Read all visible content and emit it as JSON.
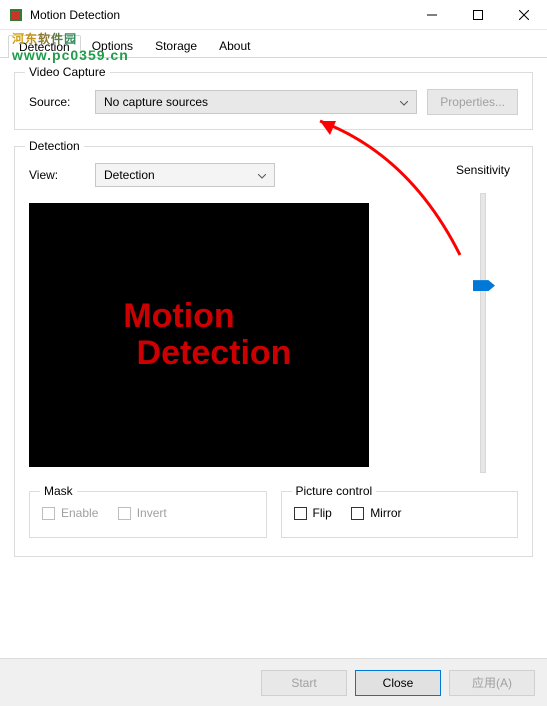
{
  "window": {
    "title": "Motion Detection"
  },
  "watermark": {
    "cn": "河东软件园",
    "url": "www.pc0359.cn"
  },
  "tabs": [
    {
      "label": "Detection",
      "active": true
    },
    {
      "label": "Options",
      "active": false
    },
    {
      "label": "Storage",
      "active": false
    },
    {
      "label": "About",
      "active": false
    }
  ],
  "video_capture": {
    "legend": "Video Capture",
    "source_label": "Source:",
    "source_value": "No capture sources",
    "properties_label": "Properties..."
  },
  "detection": {
    "legend": "Detection",
    "view_label": "View:",
    "view_value": "Detection",
    "sensitivity_label": "Sensitivity",
    "sensitivity_pos_pct": 31,
    "preview_line1": "Motion",
    "preview_line2": "Detection",
    "mask": {
      "legend": "Mask",
      "enable": "Enable",
      "invert": "Invert"
    },
    "picture": {
      "legend": "Picture control",
      "flip": "Flip",
      "mirror": "Mirror"
    }
  },
  "footer": {
    "start": "Start",
    "close": "Close",
    "apply": "应用(A)"
  }
}
